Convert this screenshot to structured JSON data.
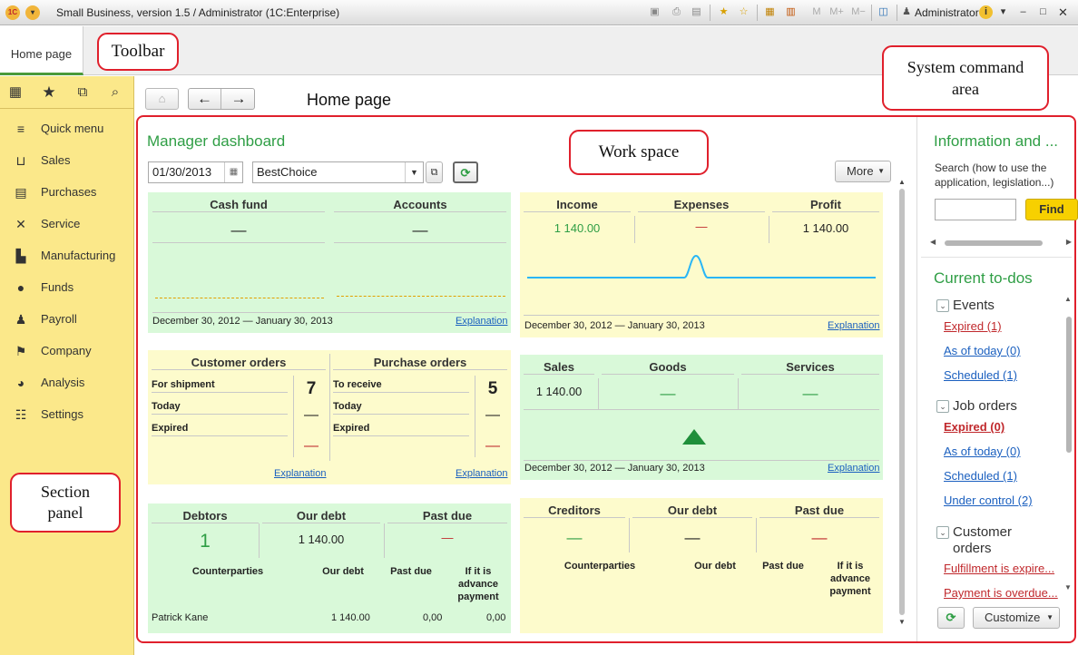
{
  "window": {
    "title": "Small Business, version 1.5 / Administrator  (1C:Enterprise)",
    "user": "Administrator",
    "memory_buttons": [
      "M",
      "M+",
      "M-"
    ],
    "icons": [
      "save-icon",
      "print-icon",
      "print-preview-icon",
      "add-favorite-icon",
      "favorites-icon",
      "calculator-icon",
      "calendar-icon",
      "panels-icon",
      "user-icon",
      "info-icon",
      "minimize-icon",
      "maximize-icon",
      "close-icon"
    ]
  },
  "tabs": {
    "home": "Home page"
  },
  "callouts": {
    "toolbar": "Toolbar",
    "system_area": "System command area",
    "work_space": "Work space",
    "section_panel": "Section panel"
  },
  "sidebar": {
    "top_icons": [
      "apps-grid-icon",
      "star-icon",
      "history-icon",
      "search-icon"
    ],
    "items": [
      {
        "label": "Quick menu",
        "icon": "menu-icon"
      },
      {
        "label": "Sales",
        "icon": "basket-icon"
      },
      {
        "label": "Purchases",
        "icon": "purchases-icon"
      },
      {
        "label": "Service",
        "icon": "tools-icon"
      },
      {
        "label": "Manufacturing",
        "icon": "factory-icon"
      },
      {
        "label": "Funds",
        "icon": "coin-icon"
      },
      {
        "label": "Payroll",
        "icon": "people-icon"
      },
      {
        "label": "Company",
        "icon": "flag-icon"
      },
      {
        "label": "Analysis",
        "icon": "pie-chart-icon"
      },
      {
        "label": "Settings",
        "icon": "settings-icon"
      }
    ]
  },
  "page": {
    "title": "Home page"
  },
  "dashboard": {
    "title": "Manager dashboard",
    "date": "01/30/2013",
    "company": "BestChoice",
    "more": "More",
    "period": "December 30, 2012 — January 30, 2013",
    "explanation": "Explanation",
    "dash": "—",
    "cash": {
      "h1": "Cash fund",
      "h2": "Accounts"
    },
    "income": {
      "h1": "Income",
      "h2": "Expenses",
      "h3": "Profit",
      "v1": "1 140.00",
      "v3": "1 140.00"
    },
    "orders": {
      "h1": "Customer orders",
      "h2": "Purchase orders",
      "c_rows": [
        "For shipment",
        "Today",
        "Expired"
      ],
      "p_rows": [
        "To receive",
        "Today",
        "Expired"
      ],
      "c_count": "7",
      "p_count": "5"
    },
    "sales": {
      "h1": "Sales",
      "h2": "Goods",
      "h3": "Services",
      "v1": "1 140.00"
    },
    "debtors": {
      "h1": "Debtors",
      "h2": "Our debt",
      "h3": "Past due",
      "v1": "1",
      "v2": "1 140.00",
      "cols": [
        "Counterparties",
        "Our debt",
        "Past due",
        "If it is advance payment"
      ],
      "row": [
        "Patrick Kane",
        "1 140.00",
        "0,00",
        "0,00"
      ]
    },
    "creditors": {
      "h1": "Creditors",
      "h2": "Our debt",
      "h3": "Past due",
      "cols": [
        "Counterparties",
        "Our debt",
        "Past due",
        "If it is advance payment"
      ]
    }
  },
  "info": {
    "title": "Information and ...",
    "search_hint": "Search (how to use the application, legislation...)",
    "find": "Find"
  },
  "todos": {
    "title": "Current to-dos",
    "events": {
      "label": "Events",
      "expired": "Expired (1)",
      "today": "As of today (0)",
      "scheduled": "Scheduled (1)"
    },
    "jobs": {
      "label": "Job orders",
      "expired": "Expired (0)",
      "today": "As of today (0)",
      "scheduled": "Scheduled (1)",
      "control": "Under control (2)"
    },
    "customer": {
      "label": "Customer orders",
      "fulfillment": "Fulfillment is expire...",
      "payment": "Payment is overdue..."
    },
    "customize": "Customize"
  },
  "colors": {
    "accent_green": "#2f9e45",
    "sidebar": "#fbe88a",
    "callout_border": "#e0202c",
    "link": "#1a5fbf",
    "expired_red": "#c0282c"
  }
}
